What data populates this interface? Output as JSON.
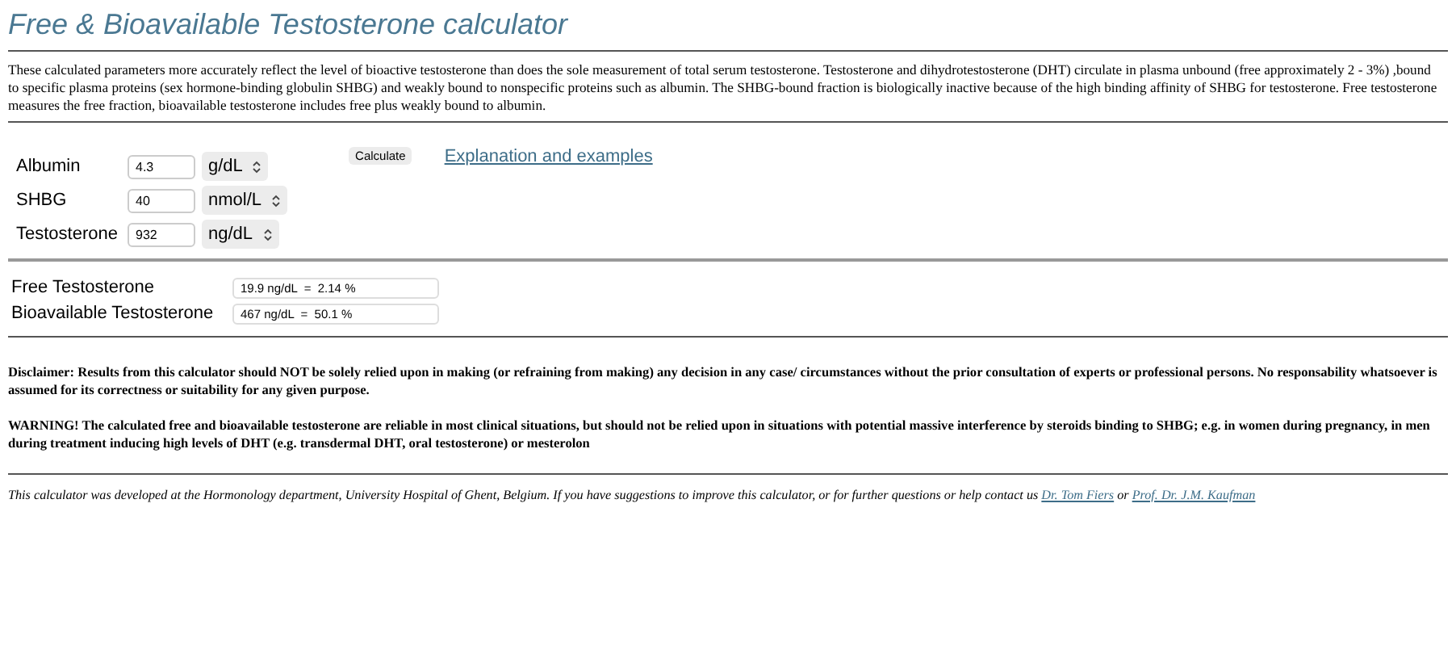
{
  "title": "Free & Bioavailable Testosterone calculator",
  "intro": "These calculated parameters more accurately reflect the level of bioactive testosterone than does the sole measurement of total serum testosterone. Testosterone and dihydrotestosterone (DHT) circulate in plasma unbound (free approximately 2 - 3%) ,bound to specific plasma proteins (sex hormone-binding globulin SHBG) and weakly bound to nonspecific proteins such as albumin. The SHBG-bound fraction is biologically inactive because of the high binding affinity of SHBG for testosterone. Free testosterone measures the free fraction, bioavailable testosterone includes free plus weakly bound to albumin.",
  "inputs": [
    {
      "label": "Albumin",
      "value": "4.3",
      "unit": "g/dL"
    },
    {
      "label": "SHBG",
      "value": "40",
      "unit": "nmol/L"
    },
    {
      "label": "Testosterone",
      "value": "932",
      "unit": "ng/dL"
    }
  ],
  "calculate_button": "Calculate",
  "help_link": "Explanation and examples",
  "results": [
    {
      "label": "Free Testosterone",
      "value": "19.9 ng/dL  =  2.14 %"
    },
    {
      "label": "Bioavailable Testosterone",
      "value": "467 ng/dL  =  50.1 %"
    }
  ],
  "disclaimer": "Disclaimer: Results from this calculator should NOT be solely relied upon in making (or refraining from making) any decision in any case/ circumstances without the prior consultation of experts or professional persons. No responsability whatsoever is assumed for its correctness or suitability for any given purpose.",
  "warning": "WARNING! The calculated free and bioavailable testosterone are reliable in most clinical situations, but should not be relied upon in situations with potential massive interference by steroids binding to SHBG; e.g. in women during pregnancy, in men during treatment inducing high levels of DHT (e.g. transdermal DHT, oral testosterone) or mesterolon",
  "footer": {
    "text": "This calculator was developed at the Hormonology department, University Hospital of Ghent, Belgium. If you have suggestions to improve this calculator, or for further questions or help contact us",
    "links": [
      "Dr. Tom Fiers",
      "Prof. Dr. J.M. Kaufman"
    ],
    "separator": "or"
  }
}
